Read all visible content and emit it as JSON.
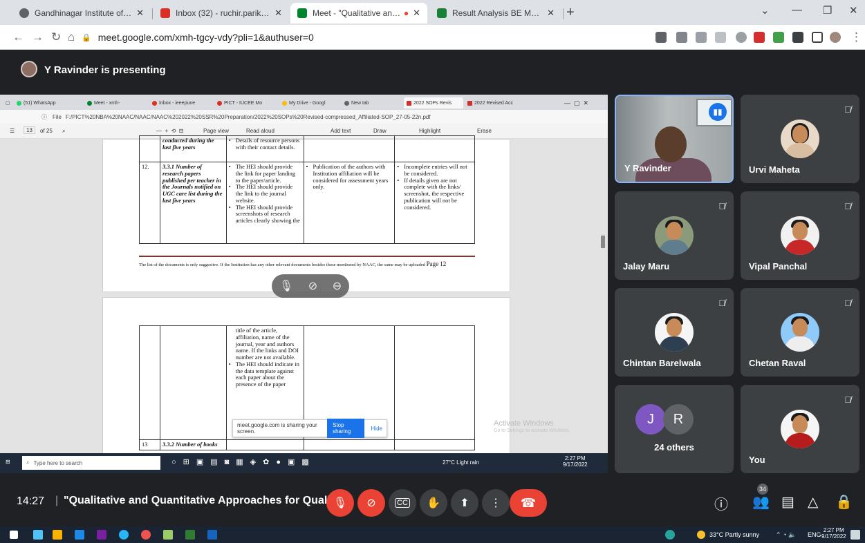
{
  "browser": {
    "tabs": [
      {
        "title": "Gandhinagar Institute of Technol",
        "color": "#3c4043"
      },
      {
        "title": "Inbox (32) - ruchir.parikh@git.org",
        "color": "#d93025"
      },
      {
        "title": "Meet - \"Qualitative and Qua",
        "color": "#00832d"
      },
      {
        "title": "Result Analysis BE Mechanical Se",
        "color": "#188038"
      }
    ],
    "url": "meet.google.com/xmh-tgcy-vdy?pli=1&authuser=0"
  },
  "presenting": {
    "text": "Y Ravinder is presenting"
  },
  "shared_screen": {
    "tabs": [
      "(51) WhatsApp",
      "Meet - xmh-",
      "Inbox - ieeepune",
      "PICT - IUCEE Mo",
      "My Drive - Googl",
      "New tab",
      "2022 SOPs Revis",
      "2022 Revised Acc"
    ],
    "file_label": "File",
    "file_path": "F:/PICT%20NBA%20NAAC/NAAC/NAAC%202022%20SSR%20Preparation/2022%20SOPs%20Revised-compressed_Affiliated-SOP_27-05-22n.pdf",
    "page_input": "13",
    "page_of": "of 25",
    "toolbar": [
      "Page view",
      "Read aloud",
      "Add text",
      "Draw",
      "Highlight",
      "Erase"
    ],
    "page1": {
      "row_prev_col2": "conducted during the last five years",
      "row_prev_col3": "Details of resource persons with their contact details.",
      "row_no": "12.",
      "metric": "3.3.1 Number of research papers published per teacher in the Journals notified on UGC care list during the last five years",
      "requirements": [
        "The HEI should provide the link for paper landing to the paper/article.",
        "The HEI should provide the link to the journal website.",
        "The HEI should provide screenshots of research articles clearly showing the"
      ],
      "assessment": "Publication of the authors with Institution affiliation will be considered for assessment years only.",
      "remarks": [
        "Incomplete entries will not be considered.",
        "If details given are not complete with the links/ screenshot, the respective publication will not be considered."
      ],
      "footnote": "The list of the documents is only suggestive. If the Institution has any other relevant documents besides those mentioned by NAAC, the same may be uploaded",
      "page_label": "Page 12"
    },
    "page2": {
      "cont_text": "title of the article, affiliation, name of the journal, year and authors name. If the links and DOI number are not available.",
      "cont_bullet": "The HEI should indicate in the data template against each paper about the presence of the paper",
      "next_no": "13",
      "next_metric": "3.3.2 Number of books"
    },
    "share_notice": {
      "text": "meet.google.com is sharing your screen.",
      "stop": "Stop sharing",
      "hide": "Hide"
    },
    "activate": {
      "title": "Activate Windows",
      "sub": "Go to Settings to activate Windows."
    },
    "taskbar": {
      "search": "Type here to search",
      "weather": "27°C Light rain",
      "time": "2:27 PM",
      "date": "9/17/2022"
    }
  },
  "participants": [
    {
      "name": "Y Ravinder",
      "muted": false
    },
    {
      "name": "Urvi Maheta",
      "muted": true
    },
    {
      "name": "Jalay Maru",
      "muted": true
    },
    {
      "name": "Vipal Panchal",
      "muted": true
    },
    {
      "name": "Chintan Barelwala",
      "muted": true
    },
    {
      "name": "Chetan Raval",
      "muted": true
    },
    {
      "name": "24 others",
      "initials": [
        "J",
        "R"
      ],
      "colors": [
        "#7e57c2",
        "#5f6368"
      ]
    },
    {
      "name": "You",
      "muted": true
    }
  ],
  "meeting": {
    "time": "14:27",
    "title": "\"Qualitative and Quantitative Approaches for Quali...",
    "participant_count": "34"
  },
  "taskbar": {
    "weather": "33°C Partly sunny",
    "lang": "ENG",
    "time": "2:27 PM",
    "date": "9/17/2022"
  }
}
